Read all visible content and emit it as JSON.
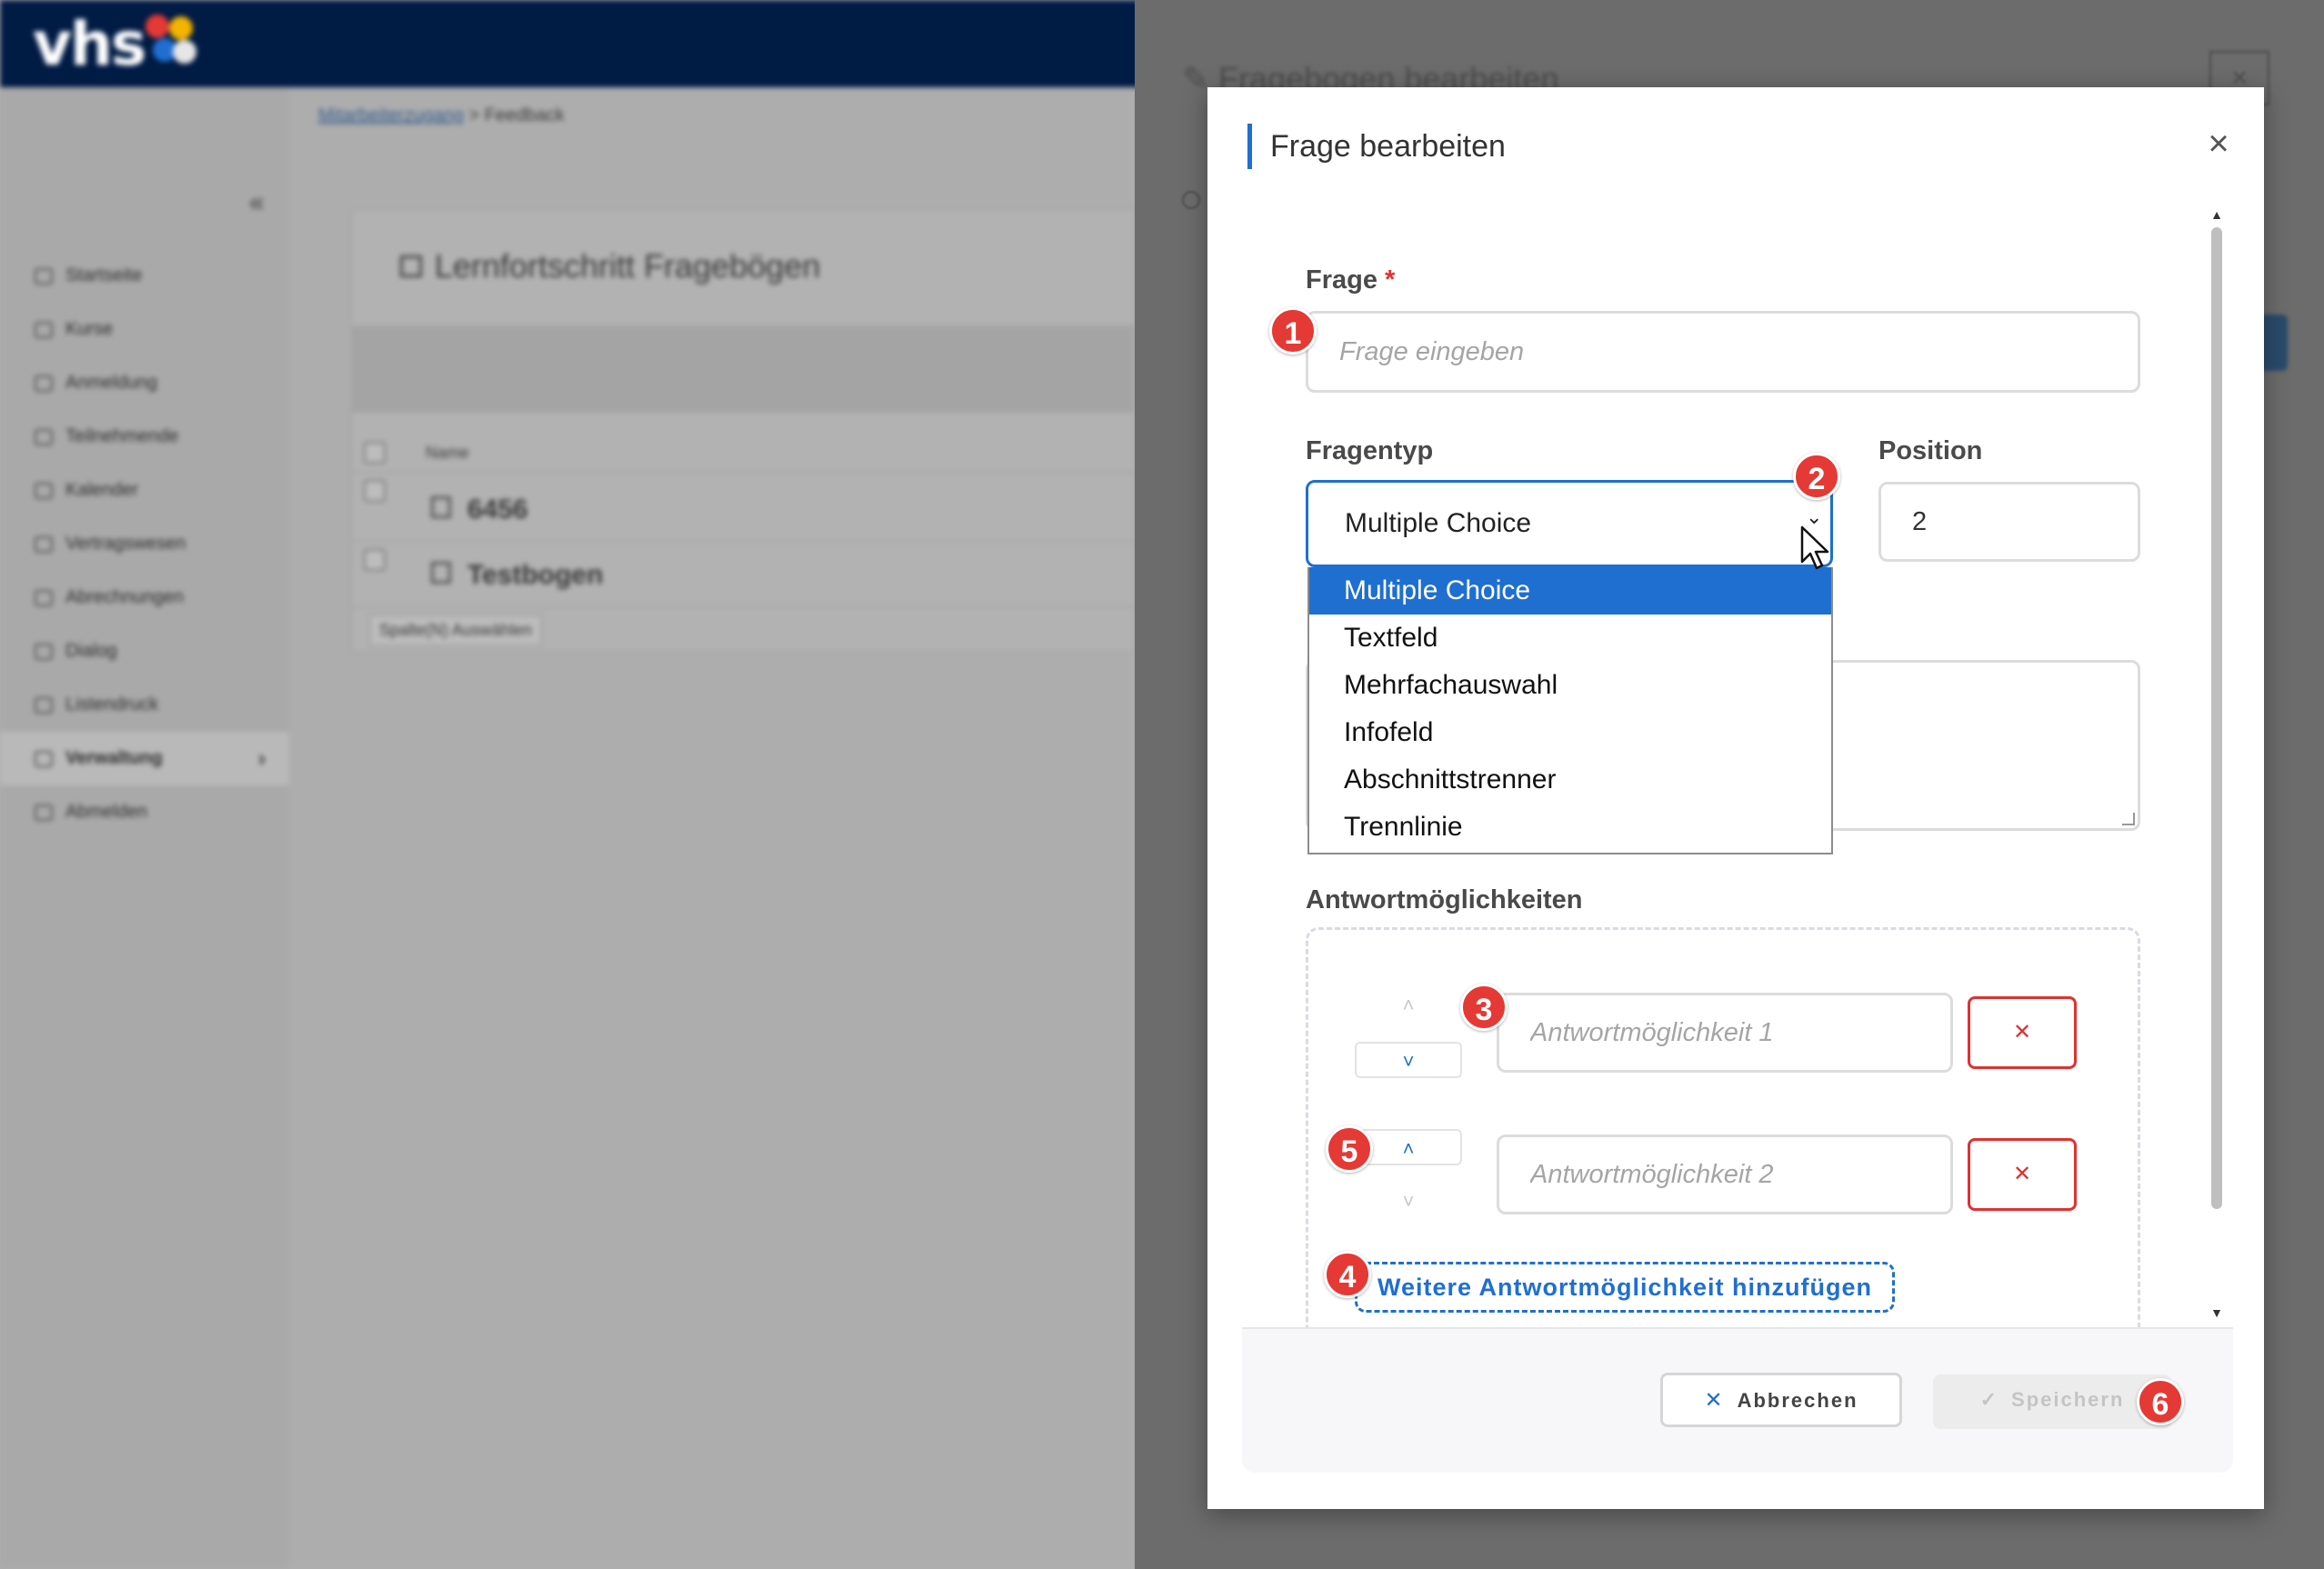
{
  "app": {
    "logo": "vhs",
    "breadcrumb": {
      "parent": "Mitarbeiterzugang",
      "separator": ">",
      "current": "Feedback"
    },
    "nav_items": [
      {
        "label": "Startseite"
      },
      {
        "label": "Kurse"
      },
      {
        "label": "Anmeldung"
      },
      {
        "label": "Teilnehmende"
      },
      {
        "label": "Kalender"
      },
      {
        "label": "Vertragswesen"
      },
      {
        "label": "Abrechnungen"
      },
      {
        "label": "Dialog"
      },
      {
        "label": "Listendruck"
      },
      {
        "label": "Verwaltung",
        "active": true
      },
      {
        "label": "Abmelden"
      }
    ],
    "card_title": "Lernfortschritt Fragebögen",
    "table": {
      "header_name": "Name",
      "rows": [
        {
          "name": "6456"
        },
        {
          "name": "Testbogen"
        }
      ],
      "column_select": "Spalte(N) Auswählen"
    },
    "panel_title": "Fragebogen bearbeiten"
  },
  "modal": {
    "title": "Frage bearbeiten",
    "close_symbol": "×",
    "question": {
      "label": "Frage",
      "required_mark": "*",
      "placeholder": "Frage eingeben",
      "value": ""
    },
    "question_type": {
      "label": "Fragentyp",
      "selected": "Multiple Choice",
      "options": [
        "Multiple Choice",
        "Textfeld",
        "Mehrfachauswahl",
        "Infofeld",
        "Abschnittstrenner",
        "Trennlinie"
      ]
    },
    "position": {
      "label": "Position",
      "value": "2"
    },
    "answers": {
      "label": "Antwortmöglichkeiten",
      "items": [
        {
          "placeholder": "Antwortmöglichkeit 1",
          "value": ""
        },
        {
          "placeholder": "Antwortmöglichkeit 2",
          "value": ""
        }
      ],
      "add_label": "Weitere Antwortmöglichkeit hinzufügen"
    },
    "footer": {
      "cancel_label": "Abbrechen",
      "save_label": "Speichern"
    }
  },
  "badges": [
    "1",
    "2",
    "3",
    "4",
    "5",
    "6"
  ],
  "colors": {
    "accent": "#1f6fd1",
    "danger": "#e03131",
    "badge": "#e53935",
    "topbar": "#001b44"
  }
}
